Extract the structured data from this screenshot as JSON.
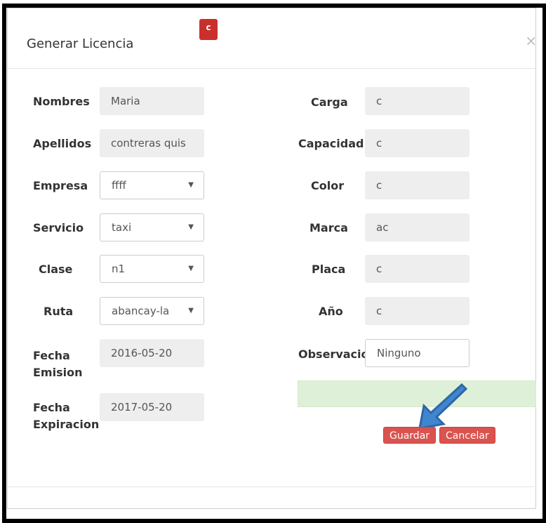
{
  "modal": {
    "title": "Generar Licencia",
    "badge": "c",
    "close": "×"
  },
  "left": [
    {
      "label": "Nombres",
      "value": "Maria",
      "type": "text"
    },
    {
      "label": "Apellidos",
      "value": "contreras quis",
      "type": "text"
    },
    {
      "label": "Empresa",
      "value": "ffff",
      "type": "select"
    },
    {
      "label": "Servicio",
      "value": "taxi",
      "type": "select"
    },
    {
      "label": "Clase",
      "value": "n1",
      "type": "select"
    },
    {
      "label": "Ruta",
      "value": "abancay-la",
      "type": "select"
    },
    {
      "label": "Fecha Emision",
      "value": "2016-05-20",
      "type": "text"
    },
    {
      "label": "Fecha Expiracion",
      "value": "2017-05-20",
      "type": "text"
    }
  ],
  "right": [
    {
      "label": "Carga",
      "value": "c"
    },
    {
      "label": "Capacidad",
      "value": "c"
    },
    {
      "label": "Color",
      "value": "c"
    },
    {
      "label": "Marca",
      "value": "ac"
    },
    {
      "label": "Placa",
      "value": "c"
    },
    {
      "label": "Año",
      "value": "c"
    },
    {
      "label": "Observacio",
      "value": "Ninguno"
    }
  ],
  "buttons": {
    "save": "Guardar",
    "cancel": "Cancelar"
  },
  "colors": {
    "danger": "#d9534f",
    "success_bg": "#dff0d8",
    "arrow": "#3f86d1"
  }
}
